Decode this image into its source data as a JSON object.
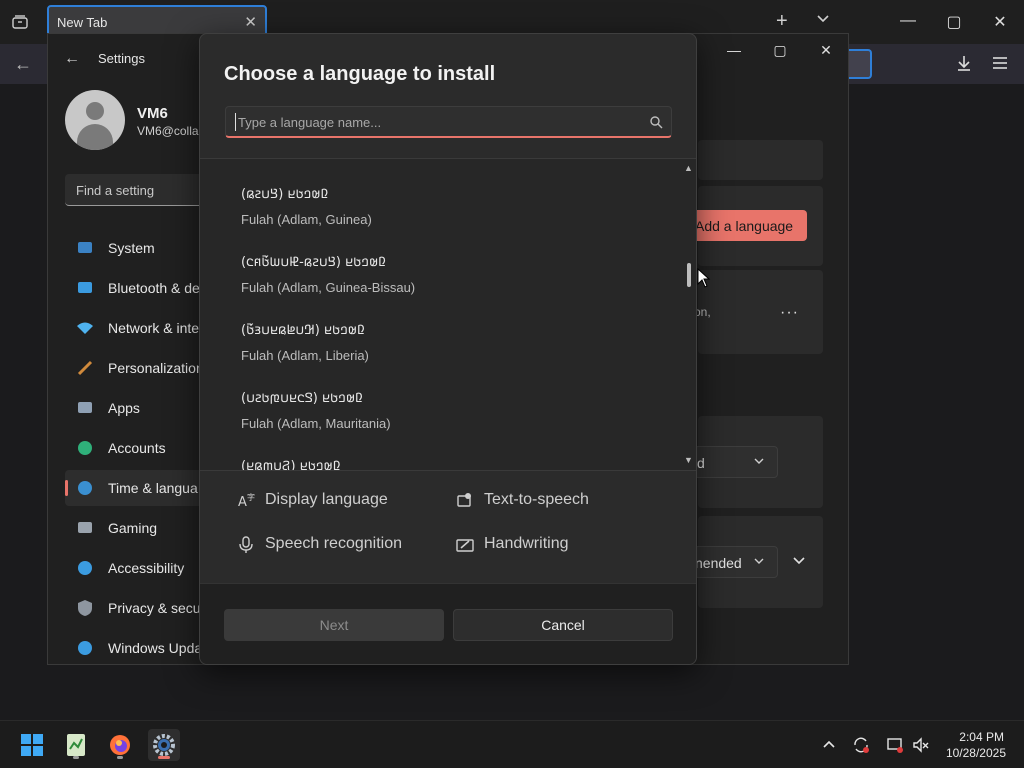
{
  "browser": {
    "tab_title": "New Tab",
    "tab_close": "✕",
    "new_tab": "+",
    "tab_dropdown": "⌵",
    "minimize": "—",
    "maximize": "▢",
    "close": "✕"
  },
  "settings": {
    "title": "Settings",
    "user_name": "VM6",
    "user_email": "VM6@collal",
    "search_placeholder": "Find a setting",
    "nav": [
      {
        "label": "System",
        "icon": "monitor-icon",
        "color": "#3b82c4"
      },
      {
        "label": "Bluetooth & de",
        "icon": "bluetooth-icon",
        "color": "#3b9be0"
      },
      {
        "label": "Network & inte",
        "icon": "wifi-icon",
        "color": "#4fb3f0"
      },
      {
        "label": "Personalization",
        "icon": "brush-icon",
        "color": "#d08a3c"
      },
      {
        "label": "Apps",
        "icon": "apps-icon",
        "color": "#8fa0b4"
      },
      {
        "label": "Accounts",
        "icon": "person-icon",
        "color": "#2fb07a"
      },
      {
        "label": "Time & langua",
        "icon": "globe-clock-icon",
        "color": "#3a8fd0"
      },
      {
        "label": "Gaming",
        "icon": "gamepad-icon",
        "color": "#9aa3ad"
      },
      {
        "label": "Accessibility",
        "icon": "accessibility-icon",
        "color": "#3b9be0"
      },
      {
        "label": "Privacy & secu",
        "icon": "shield-icon",
        "color": "#8e96a0"
      },
      {
        "label": "Windows Upda",
        "icon": "update-icon",
        "color": "#3b9be0"
      }
    ],
    "add_language": "Add a language",
    "card_fragment_1": "on,",
    "card_dots": "···",
    "select_fragment_1": "d",
    "select_fragment_2": "nended"
  },
  "dialog": {
    "title": "Choose a language to install",
    "search_placeholder": "Type a language name...",
    "languages": [
      {
        "native": "(𞤘𞤭𞤲𞤫) 𞤆𞤵𞤤𞤢𞤪",
        "english": "Fulah (Adlam, Guinea)"
      },
      {
        "native": "(𞤘𞤭𞤲𞤫-𞤄𞤭𞤧𞤢𞥄𞤱𞤮) 𞤆𞤵𞤤𞤢𞤪",
        "english": "Fulah (Adlam, Guinea-Bissau)"
      },
      {
        "native": "(𞤂𞤭𞤦𞤫𞤪𞤭𞤴𞤢𞥄) 𞤆𞤵𞤤𞤢𞤪",
        "english": "Fulah (Adlam, Liberia)"
      },
      {
        "native": "(𞤃𞤮𞤪𞤭𞤼𞤢𞤲𞤭) 𞤆𞤵𞤤𞤢𞤪",
        "english": "Fulah (Adlam, Mauritania)"
      },
      {
        "native": "(𞤐𞤭𞤶𞤫𞤪) 𞤆𞤵𞤤𞤢𞤪",
        "english": ""
      }
    ],
    "features": [
      {
        "label": "Display language",
        "icon": "display-language-icon"
      },
      {
        "label": "Text-to-speech",
        "icon": "text-to-speech-icon"
      },
      {
        "label": "Speech recognition",
        "icon": "microphone-icon"
      },
      {
        "label": "Handwriting",
        "icon": "handwriting-icon"
      }
    ],
    "next": "Next",
    "cancel": "Cancel"
  },
  "taskbar": {
    "time": "2:04 PM",
    "date": "10/28/2025",
    "apps": [
      "windows-start-icon",
      "notepad-icon",
      "firefox-icon",
      "settings-gear-icon"
    ]
  }
}
